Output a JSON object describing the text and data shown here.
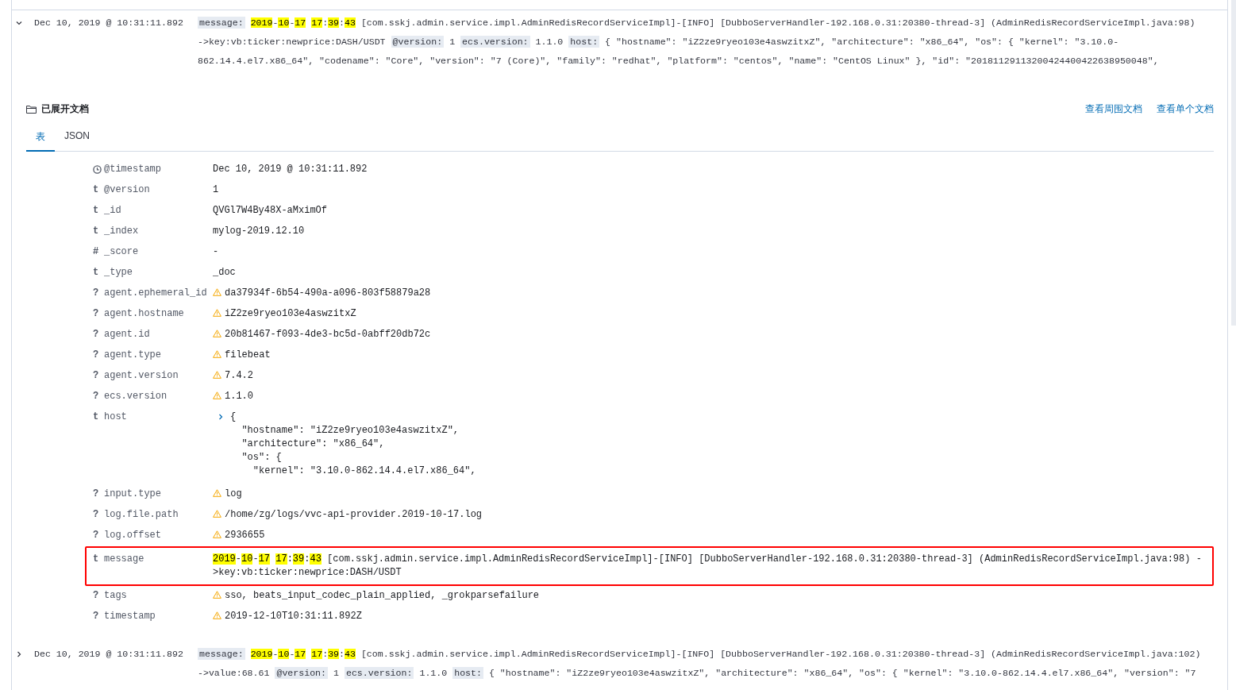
{
  "documents_before": [
    {
      "expanded": true,
      "time": "Dec 10, 2019 @ 10:31:11.892",
      "summary_lines": [
        [
          {
            "kind": "key",
            "text": "message:"
          },
          {
            "kind": "date",
            "text": "2019-10-17 17:39:43"
          },
          {
            "kind": "plain",
            "text": "[com.sskj.admin.service.impl.AdminRedisRecordServiceImpl]-[INFO] [DubboServerHandler-192.168.0.31:20380-thread-3] (AdminRedisRecordServiceImpl.java:98)"
          }
        ],
        [
          {
            "kind": "plain",
            "text": "->key:vb:ticker:newprice:DASH/USDT"
          },
          {
            "kind": "key",
            "text": "@version:"
          },
          {
            "kind": "plain",
            "text": "1"
          },
          {
            "kind": "key",
            "text": "ecs.version:"
          },
          {
            "kind": "plain",
            "text": "1.1.0"
          },
          {
            "kind": "key",
            "text": "host:"
          },
          {
            "kind": "plain",
            "text": "{ \"hostname\": \"iZ2ze9ryeo103e4aswzitxZ\", \"architecture\": \"x86_64\", \"os\": { \"kernel\": \"3.10.0-"
          }
        ],
        [
          {
            "kind": "plain",
            "text": "862.14.4.el7.x86_64\", \"codename\": \"Core\", \"version\": \"7 (Core)\", \"family\": \"redhat\", \"platform\": \"centos\", \"name\": \"CentOS Linux\" }, \"id\": \"20181129113200424400422638950048\","
          }
        ]
      ]
    }
  ],
  "detail": {
    "title": "已展开文档",
    "links": [
      "查看周围文档",
      "查看单个文档"
    ],
    "tabs": [
      {
        "label": "表",
        "selected": true
      },
      {
        "label": "JSON",
        "selected": false
      }
    ],
    "fields": [
      {
        "kind": "date",
        "name": "@timestamp",
        "warning": false,
        "value": "Dec 10, 2019 @ 10:31:11.892"
      },
      {
        "kind": "string",
        "type_label": "t",
        "name": "@version",
        "warning": false,
        "value": "1"
      },
      {
        "kind": "string",
        "type_label": "t",
        "name": "_id",
        "warning": false,
        "value": "QVGl7W4By48X-aMximOf"
      },
      {
        "kind": "string",
        "type_label": "t",
        "name": "_index",
        "warning": false,
        "value": "mylog-2019.12.10"
      },
      {
        "kind": "string",
        "type_label": "#",
        "name": "_score",
        "warning": false,
        "value": " -"
      },
      {
        "kind": "string",
        "type_label": "t",
        "name": "_type",
        "warning": false,
        "value": "_doc"
      },
      {
        "kind": "string",
        "type_label": "?",
        "name": "agent.ephemeral_id",
        "warning": true,
        "value": "da37934f-6b54-490a-a096-803f58879a28"
      },
      {
        "kind": "string",
        "type_label": "?",
        "name": "agent.hostname",
        "warning": true,
        "value": "iZ2ze9ryeo103e4aswzitxZ"
      },
      {
        "kind": "string",
        "type_label": "?",
        "name": "agent.id",
        "warning": true,
        "value": "20b81467-f093-4de3-bc5d-0abff20db72c"
      },
      {
        "kind": "string",
        "type_label": "?",
        "name": "agent.type",
        "warning": true,
        "value": "filebeat"
      },
      {
        "kind": "string",
        "type_label": "?",
        "name": "agent.version",
        "warning": true,
        "value": "7.4.2"
      },
      {
        "kind": "string",
        "type_label": "?",
        "name": "ecs.version",
        "warning": true,
        "value": "1.1.0"
      },
      {
        "kind": "object",
        "type_label": "t",
        "name": "host",
        "warning": false,
        "value_lines": [
          "{",
          "  \"hostname\": \"iZ2ze9ryeo103e4aswzitxZ\",",
          "  \"architecture\": \"x86_64\",",
          "  \"os\": {",
          "    \"kernel\": \"3.10.0-862.14.4.el7.x86_64\","
        ]
      },
      {
        "kind": "string",
        "type_label": "?",
        "name": "input.type",
        "warning": true,
        "value": "log"
      },
      {
        "kind": "string",
        "type_label": "?",
        "name": "log.file.path",
        "warning": true,
        "value": "/home/zg/logs/vvc-api-provider.2019-10-17.log"
      },
      {
        "kind": "string",
        "type_label": "?",
        "name": "log.offset",
        "warning": true,
        "value": "2936655"
      },
      {
        "kind": "message",
        "type_label": "t",
        "name": "message",
        "warning": false,
        "outlined": true,
        "segments": [
          {
            "kind": "date",
            "text": "2019-10-17 17:39:43"
          },
          {
            "kind": "plain",
            "text": "[com.sskj.admin.service.impl.AdminRedisRecordServiceImpl]-[INFO] [DubboServerHandler-192.168.0.31:20380-thread-3] (AdminRedisRecordServiceImpl.java:98) ->key:vb:ticker:newprice:DASH/USDT"
          }
        ]
      },
      {
        "kind": "string",
        "type_label": "?",
        "name": "tags",
        "warning": true,
        "value": "sso, beats_input_codec_plain_applied, _grokparsefailure"
      },
      {
        "kind": "string",
        "type_label": "?",
        "name": "timestamp",
        "warning": true,
        "value": "2019-12-10T10:31:11.892Z"
      }
    ]
  },
  "documents_after": [
    {
      "expanded": false,
      "time": "Dec 10, 2019 @ 10:31:11.892",
      "summary_lines": [
        [
          {
            "kind": "key",
            "text": "message:"
          },
          {
            "kind": "date",
            "text": "2019-10-17 17:39:43"
          },
          {
            "kind": "plain",
            "text": "[com.sskj.admin.service.impl.AdminRedisRecordServiceImpl]-[INFO] [DubboServerHandler-192.168.0.31:20380-thread-3] (AdminRedisRecordServiceImpl.java:102)"
          }
        ],
        [
          {
            "kind": "plain",
            "text": "->value:68.61"
          },
          {
            "kind": "key",
            "text": "@version:"
          },
          {
            "kind": "plain",
            "text": "1"
          },
          {
            "kind": "key",
            "text": "ecs.version:"
          },
          {
            "kind": "plain",
            "text": "1.1.0"
          },
          {
            "kind": "key",
            "text": "host:"
          },
          {
            "kind": "plain",
            "text": "{ \"hostname\": \"iZ2ze9ryeo103e4aswzitxZ\", \"architecture\": \"x86_64\", \"os\": { \"kernel\": \"3.10.0-862.14.4.el7.x86_64\", \"version\": \"7"
          }
        ]
      ]
    }
  ]
}
